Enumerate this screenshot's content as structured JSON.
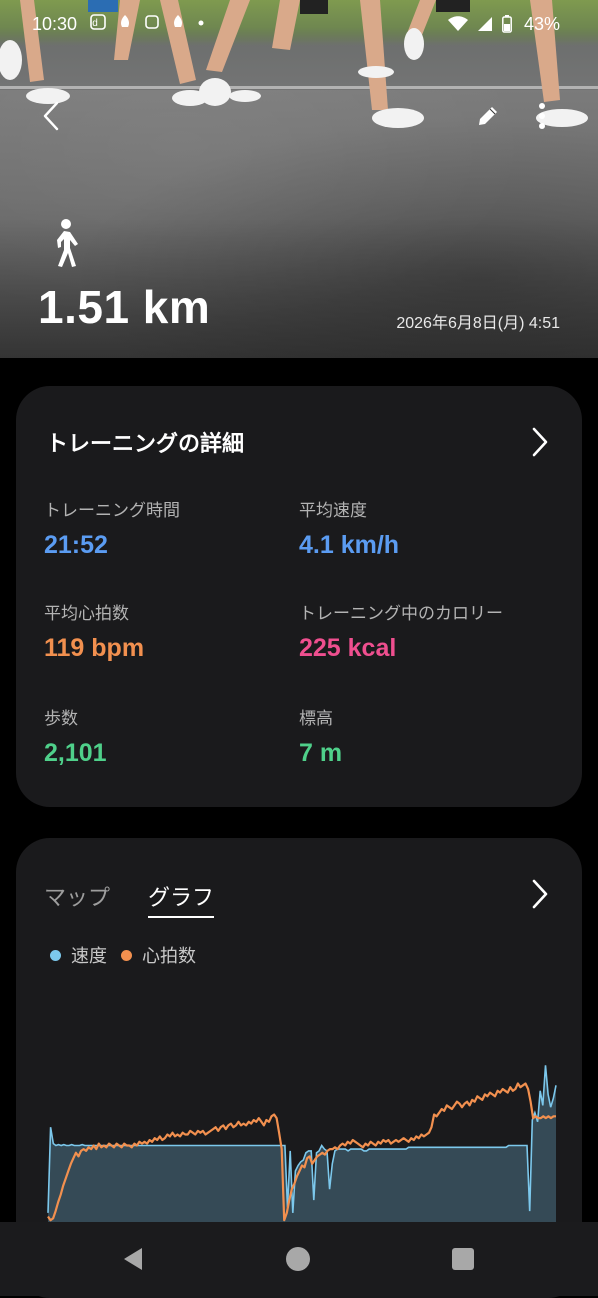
{
  "status_bar": {
    "time": "10:30",
    "battery": "43%",
    "left_icons": [
      "notification-d-icon",
      "app-icon",
      "app-icon",
      "app-icon",
      "dot-icon"
    ],
    "right_icons": [
      "wifi-icon",
      "signal-icon",
      "battery-icon"
    ]
  },
  "hero": {
    "distance": "1.51 km",
    "date": "2026年6月8日(月) 4:51",
    "activity_icon": "walking-icon",
    "actions": [
      "back-icon",
      "edit-icon",
      "more-icon"
    ]
  },
  "details": {
    "title": "トレーニングの詳細",
    "stats": [
      {
        "label": "トレーニング時間",
        "value": "21:52",
        "color": "#5b9cf2"
      },
      {
        "label": "平均速度",
        "value": "4.1 km/h",
        "color": "#5b9cf2"
      },
      {
        "label": "平均心拍数",
        "value": "119 bpm",
        "color": "#f2904f"
      },
      {
        "label": "トレーニング中のカロリー",
        "value": "225 kcal",
        "color": "#ef4f8f"
      },
      {
        "label": "歩数",
        "value": "2,101",
        "color": "#4fd08a"
      },
      {
        "label": "標高",
        "value": "7 m",
        "color": "#4fd08a"
      }
    ]
  },
  "graph_card": {
    "tabs": [
      "マップ",
      "グラフ"
    ],
    "selected_tab": "グラフ",
    "legend": [
      {
        "label": "速度",
        "color": "#7cc8ec"
      },
      {
        "label": "心拍数",
        "color": "#f2904f"
      }
    ]
  },
  "chart_data": {
    "type": "line",
    "series": [
      {
        "name": "速度",
        "color": "#7cc8ec",
        "values": [
          0.5,
          5.2,
          4.3,
          4.2,
          4.25,
          4.2,
          4.25,
          4.2,
          4.2,
          4.25,
          4.2,
          4.2,
          4.2,
          4.25,
          4.2,
          4.2,
          4.2,
          4.2,
          4.2,
          4.2,
          4.2,
          4.2,
          4.2,
          4.2,
          4.2,
          4.2,
          4.2,
          4.2,
          4.2,
          4.2,
          4.2,
          4.2,
          4.2,
          4.2,
          4.2,
          4.2,
          4.2,
          4.2,
          4.2,
          4.2,
          4.2,
          4.2,
          4.2,
          4.2,
          4.2,
          4.2,
          4.2,
          4.2,
          4.2,
          4.2,
          4.2,
          4.2,
          4.2,
          4.2,
          4.2,
          4.2,
          4.2,
          4.2,
          4.2,
          4.2,
          4.2,
          4.2,
          4.2,
          4.2,
          4.2,
          4.2,
          4.2,
          4.2,
          4.2,
          4.2,
          4.2,
          4.2,
          4.2,
          4.2,
          4.2,
          4.2,
          4.2,
          4.2,
          4.2,
          4.2,
          4.2,
          4.2,
          4.2,
          4.2,
          4.2,
          4.2,
          4.2,
          4.2,
          4.2,
          4.2,
          4.2,
          0.8,
          3.9,
          0.5,
          2.8,
          3.1,
          3.3,
          3.4,
          3.8,
          3.9,
          3.9,
          1.2,
          3.8,
          3.9,
          4.2,
          4.0,
          3.9,
          1.8,
          3.2,
          3.9,
          4.0,
          4.0,
          4.0,
          4.0,
          3.9,
          4.0,
          4.0,
          4.0,
          4.0,
          4.0,
          3.9,
          3.9,
          4.0,
          4.0,
          4.0,
          4.0,
          4.0,
          4.0,
          4.0,
          4.0,
          4.0,
          4.0,
          4.0,
          4.0,
          4.0,
          4.0,
          4.0,
          4.1,
          4.1,
          4.1,
          4.1,
          4.1,
          4.1,
          4.1,
          4.1,
          4.1,
          4.1,
          4.1,
          4.1,
          4.1,
          4.1,
          4.1,
          4.1,
          4.1,
          4.1,
          4.1,
          4.1,
          4.1,
          4.1,
          4.1,
          4.1,
          4.1,
          4.1,
          4.1,
          4.1,
          4.1,
          4.1,
          4.1,
          4.1,
          4.1,
          4.1,
          4.1,
          4.1,
          4.1,
          4.1,
          4.2,
          4.2,
          4.2,
          4.2,
          4.2,
          4.2,
          4.2,
          4.2,
          0.6,
          5.6,
          6.0,
          5.5,
          7.2,
          6.4,
          8.6,
          7.0,
          6.3,
          6.8,
          7.5
        ]
      },
      {
        "name": "心拍数",
        "color": "#f2904f",
        "values": [
          0.3,
          0.1,
          0.2,
          0.6,
          1.1,
          1.5,
          2.0,
          2.4,
          2.8,
          3.2,
          3.5,
          3.8,
          3.6,
          3.9,
          4.0,
          3.9,
          4.1,
          4.0,
          4.2,
          4.0,
          4.3,
          4.1,
          4.2,
          4.1,
          4.3,
          4.2,
          4.1,
          4.3,
          4.2,
          4.1,
          4.3,
          4.2,
          4.2,
          4.1,
          4.3,
          4.2,
          4.4,
          4.3,
          4.4,
          4.3,
          4.5,
          4.4,
          4.6,
          4.5,
          4.7,
          4.5,
          4.6,
          4.8,
          4.7,
          4.9,
          4.7,
          4.8,
          4.7,
          4.9,
          4.8,
          4.8,
          5.0,
          4.9,
          4.8,
          5.0,
          4.9,
          5.0,
          4.8,
          4.9,
          5.0,
          5.1,
          5.2,
          5.0,
          5.2,
          5.3,
          5.1,
          5.3,
          5.4,
          5.2,
          5.3,
          5.5,
          5.3,
          5.4,
          5.3,
          5.5,
          5.4,
          5.6,
          5.5,
          5.7,
          5.5,
          5.3,
          5.6,
          5.5,
          5.8,
          5.9,
          5.7,
          4.9,
          4.0,
          0.1,
          0.5,
          1.2,
          1.8,
          2.1,
          2.5,
          2.8,
          3.1,
          3.0,
          3.5,
          3.6,
          3.2,
          3.4,
          3.6,
          3.7,
          3.8,
          3.7,
          3.9,
          4.0,
          4.0,
          4.1,
          4.0,
          4.2,
          4.3,
          4.2,
          4.4,
          4.3,
          4.5,
          4.4,
          4.3,
          4.2,
          4.1,
          4.3,
          4.2,
          4.4,
          4.3,
          4.2,
          4.4,
          4.3,
          4.5,
          4.4,
          4.5,
          4.3,
          4.4,
          4.5,
          4.4,
          4.5,
          4.6,
          4.5,
          4.4,
          4.6,
          4.5,
          4.7,
          4.6,
          4.8,
          4.7,
          4.8,
          4.9,
          5.2,
          5.9,
          5.8,
          6.0,
          6.2,
          6.1,
          6.4,
          6.3,
          6.2,
          6.4,
          6.6,
          6.5,
          6.3,
          6.5,
          6.6,
          6.4,
          6.7,
          6.6,
          6.9,
          6.8,
          6.7,
          7.0,
          6.9,
          7.1,
          7.0,
          6.9,
          7.2,
          7.1,
          7.3,
          7.2,
          7.1,
          7.4,
          7.2,
          7.3,
          7.6,
          7.4,
          7.5,
          7.6,
          7.3,
          6.6,
          5.7,
          5.8,
          5.7,
          5.7,
          5.8,
          5.7,
          5.8,
          5.7,
          5.8,
          5.8
        ]
      }
    ]
  },
  "navbar": {
    "buttons": [
      "back-triangle-icon",
      "home-circle-icon",
      "recents-square-icon"
    ]
  }
}
